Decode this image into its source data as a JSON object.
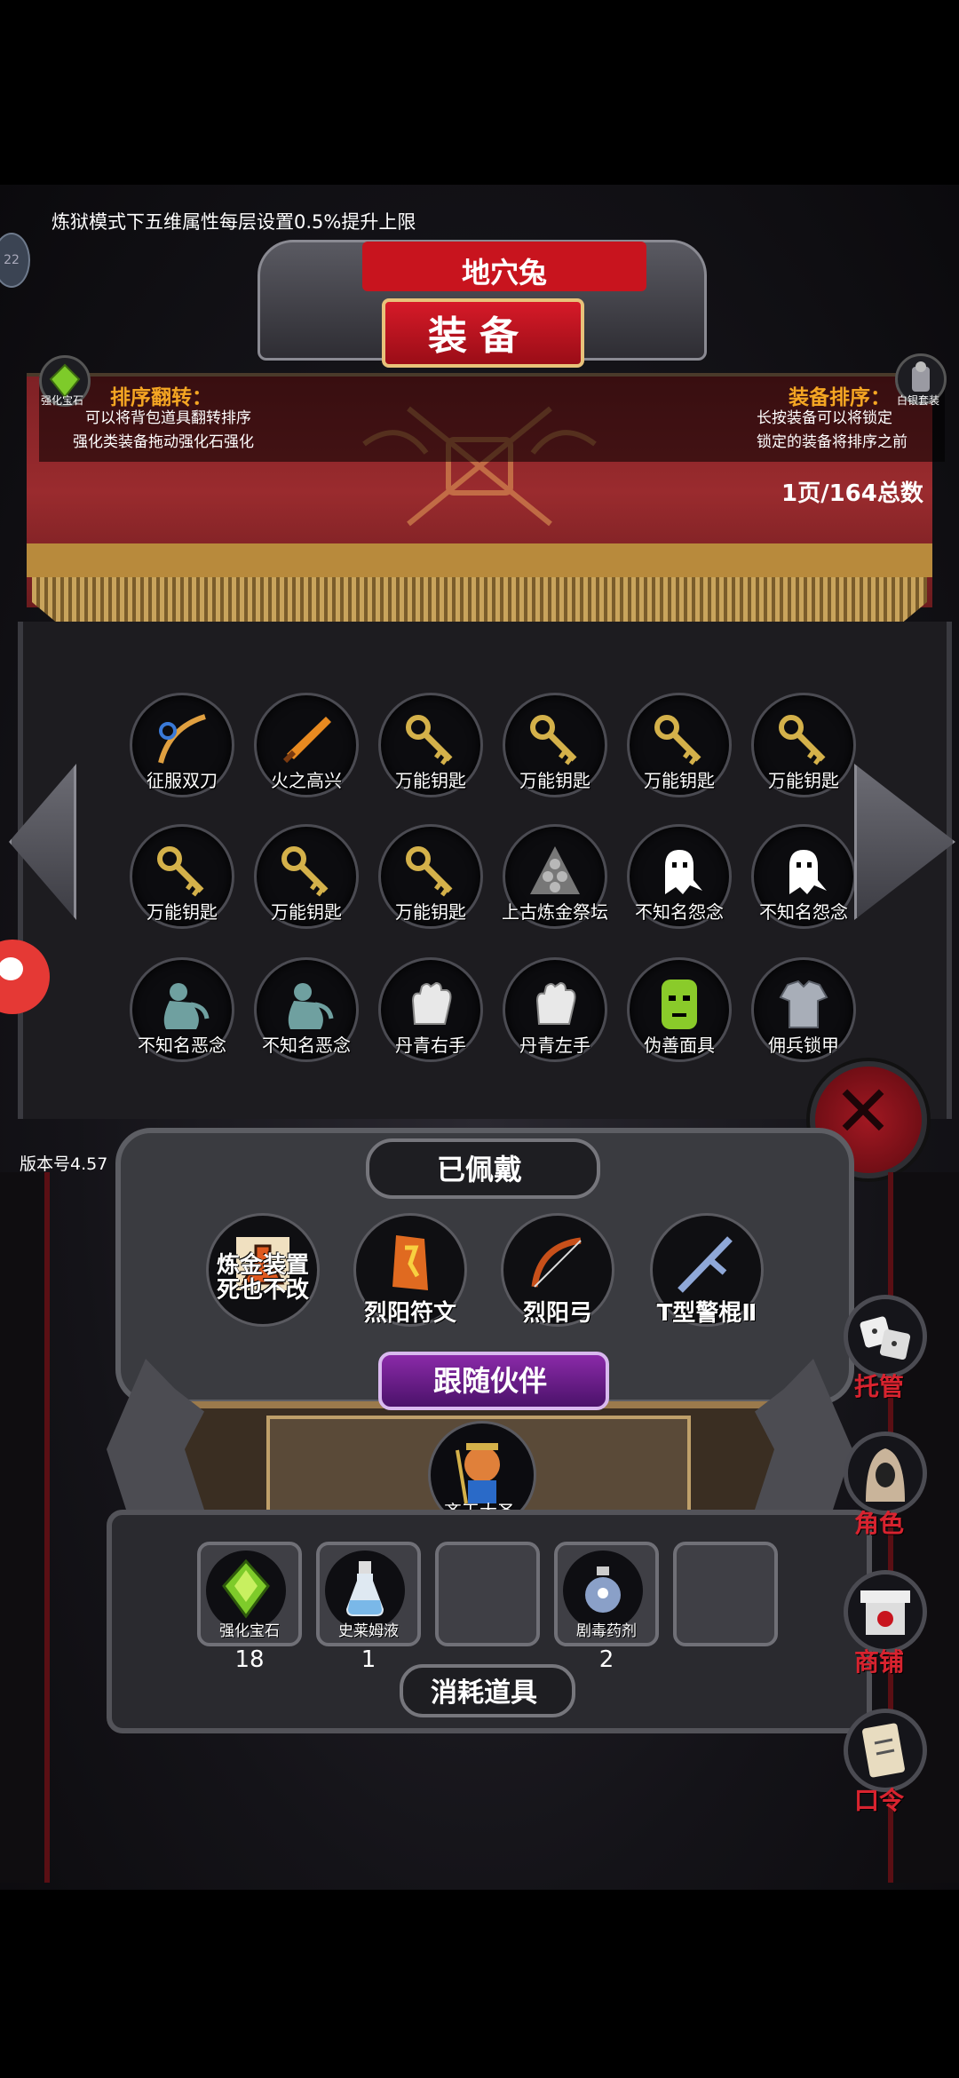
{
  "notice": "炼狱模式下五维属性每层设置0.5%提升上限",
  "tier_badge": "22",
  "header": {
    "ribbon": "地穴兔",
    "title": "装备"
  },
  "left_hint": {
    "icon_label": "强化宝石",
    "title": "排序翻转：",
    "lines": [
      "可以将背包道具翻转排序",
      "强化类装备拖动强化石强化"
    ]
  },
  "right_hint": {
    "icon_label": "白银套装",
    "title": "装备排序：",
    "lines": [
      "长按装备可以将锁定",
      "锁定的装备将排序之前"
    ]
  },
  "page_count": "1页/164总数",
  "inventory": [
    {
      "label": "征服双刀",
      "icon": "twin-blades-icon",
      "color": "#e0a040"
    },
    {
      "label": "火之高兴",
      "icon": "flame-sword-icon",
      "color": "#e88a20"
    },
    {
      "label": "万能钥匙",
      "icon": "golden-key-icon",
      "color": "#d4b14a"
    },
    {
      "label": "万能钥匙",
      "icon": "golden-key-icon",
      "color": "#d4b14a"
    },
    {
      "label": "万能钥匙",
      "icon": "golden-key-icon",
      "color": "#d4b14a"
    },
    {
      "label": "万能钥匙",
      "icon": "golden-key-icon",
      "color": "#d4b14a"
    },
    {
      "label": "万能钥匙",
      "icon": "golden-key-icon",
      "color": "#d4b14a"
    },
    {
      "label": "万能钥匙",
      "icon": "golden-key-icon",
      "color": "#d4b14a"
    },
    {
      "label": "万能钥匙",
      "icon": "golden-key-icon",
      "color": "#d4b14a"
    },
    {
      "label": "上古炼金祭坛",
      "icon": "skull-altar-icon",
      "color": "#b8b8b8"
    },
    {
      "label": "不知名怨念",
      "icon": "ghost-icon",
      "color": "#ffffff"
    },
    {
      "label": "不知名怨念",
      "icon": "ghost-icon",
      "color": "#ffffff"
    },
    {
      "label": "不知名恶念",
      "icon": "wraith-icon",
      "color": "#6fa0a0"
    },
    {
      "label": "不知名恶念",
      "icon": "wraith-icon",
      "color": "#6fa0a0"
    },
    {
      "label": "丹青右手",
      "icon": "glove-icon",
      "color": "#e8e8e8"
    },
    {
      "label": "丹青左手",
      "icon": "glove-icon",
      "color": "#e8e8e8"
    },
    {
      "label": "伪善面具",
      "icon": "mask-icon",
      "color": "#8acb2a"
    },
    {
      "label": "佣兵锁甲",
      "icon": "chainmail-icon",
      "color": "#a8aeb8"
    }
  ],
  "version": "版本号4.57",
  "equipped": {
    "tab": "已佩戴",
    "items": [
      {
        "label": "炼金装置\n死也不改",
        "icon": "flask-icon",
        "color": "#e05a20"
      },
      {
        "label": "烈阳符文",
        "icon": "rune-icon",
        "color": "#e06a20"
      },
      {
        "label": "烈阳弓",
        "icon": "bow-icon",
        "color": "#c8501a"
      },
      {
        "label": "T型警棍Ⅱ",
        "icon": "baton-icon",
        "color": "#8fa8d8"
      }
    ]
  },
  "partner": {
    "tab": "跟随伙伴",
    "name": "齐天大圣"
  },
  "consumables": {
    "tab": "消耗道具",
    "items": [
      {
        "label": "强化宝石",
        "count": "18",
        "icon": "green-gem-icon",
        "color": "#7ecb2a"
      },
      {
        "label": "史莱姆液",
        "count": "1",
        "icon": "potion-bottle-icon",
        "color": "#7ab8e8"
      },
      {
        "label": "",
        "count": "",
        "icon": "",
        "color": ""
      },
      {
        "label": "剧毒药剂",
        "count": "2",
        "icon": "poison-flask-icon",
        "color": "#8aa0c8"
      },
      {
        "label": "",
        "count": "",
        "icon": "",
        "color": ""
      }
    ]
  },
  "side_menu": [
    {
      "label": "托管",
      "icon": "dice-icon"
    },
    {
      "label": "角色",
      "icon": "hooded-figure-icon"
    },
    {
      "label": "商铺",
      "icon": "shop-icon"
    },
    {
      "label": "口令",
      "icon": "scroll-icon"
    }
  ],
  "accent": "#d8232f"
}
